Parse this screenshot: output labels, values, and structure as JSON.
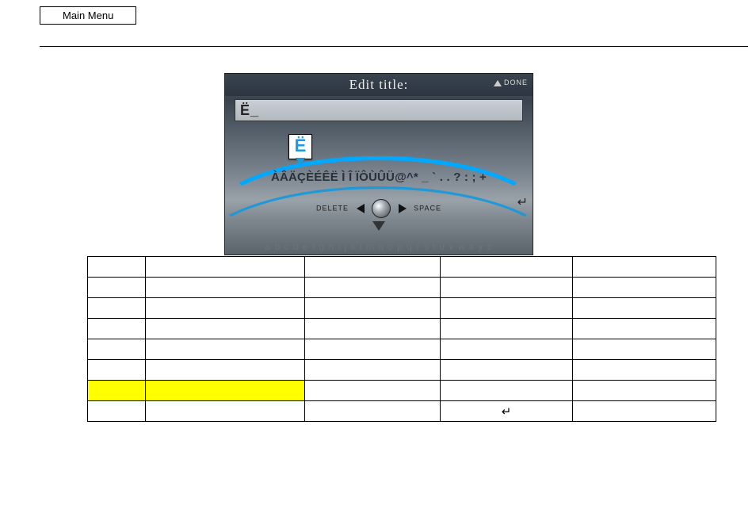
{
  "mainMenuLabel": "Main Menu",
  "screenshot": {
    "title": "Edit title:",
    "doneLabel": "DONE",
    "inputValue": "Ë_",
    "highlightChar": "Ë",
    "charRow": "ÀÂÄÇÈÉÊË Ì Î ÏÔÙÛÜ@^* _ ` . . ? : ; +",
    "deleteLabel": "DELETE",
    "spaceLabel": "SPACE",
    "bottomAlpha": "a b c d e f g h i j k l m n o p q r s t u v w x y z",
    "enterGlyph": "↵"
  },
  "table": {
    "enterGlyph": "↵"
  }
}
